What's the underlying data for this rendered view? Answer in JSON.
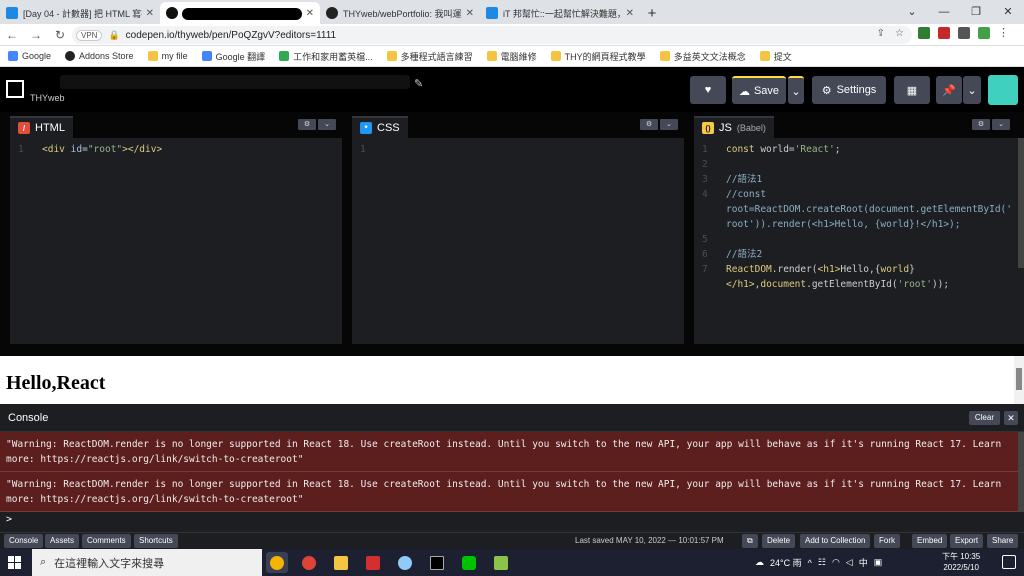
{
  "browser": {
    "tabs": [
      {
        "title": "[Day 04 - 計數器] 把 HTML 寫在",
        "icon": "ithelp-icon",
        "active": false
      },
      {
        "title": "",
        "icon": "codepen-icon",
        "active": true
      },
      {
        "title": "THYweb/webPortfolio: 我叫運動",
        "icon": "github-icon",
        "active": false
      },
      {
        "title": "iT 邦幫忙::一起幫忙解決難題，拯",
        "icon": "ithelp-icon",
        "active": false
      }
    ],
    "url": "codepen.io/thyweb/pen/PoQZgvV?editors=1111",
    "vpn_label": "VPN",
    "bookmarks": [
      "Google",
      "Addons Store",
      "my file",
      "Google 翻譯",
      "工作和家用蓄英檔...",
      "多種程式語言練習",
      "電腦維修",
      "THY的網頁程式教學",
      "多益英文文法概念",
      "提文"
    ]
  },
  "codepen": {
    "owner": "THYweb",
    "save_label": "Save",
    "settings_label": "Settings",
    "editors": {
      "html": {
        "label": "HTML",
        "lines": [
          "1"
        ]
      },
      "css": {
        "label": "CSS",
        "lines": [
          "1"
        ]
      },
      "js": {
        "label": "JS",
        "sublabel": "(Babel)"
      }
    },
    "result_heading": "Hello,React",
    "console": {
      "title": "Console",
      "clear_label": "Clear",
      "close_label": "✕",
      "warnings": [
        "\"Warning: ReactDOM.render is no longer supported in React 18. Use createRoot instead. Until you switch to the new API, your app will behave as if it's running React 17. Learn more: https://reactjs.org/link/switch-to-createroot\"",
        "\"Warning: ReactDOM.render is no longer supported in React 18. Use createRoot instead. Until you switch to the new API, your app will behave as if it's running React 17. Learn more: https://reactjs.org/link/switch-to-createroot\""
      ],
      "prompt": ">"
    },
    "footer": {
      "left_buttons": [
        "Console",
        "Assets",
        "Comments",
        "Shortcuts"
      ],
      "last_saved": "Last saved MAY 10, 2022 — 10:01:57 PM",
      "right_buttons": [
        "Delete",
        "Add to Collection",
        "Fork",
        "Embed",
        "Export",
        "Share"
      ]
    }
  },
  "taskbar": {
    "search_placeholder": "在這裡輸入文字來搜尋",
    "weather": "24°C 雨",
    "ime": "中",
    "time": "下午 10:35",
    "date": "2022/5/10"
  }
}
